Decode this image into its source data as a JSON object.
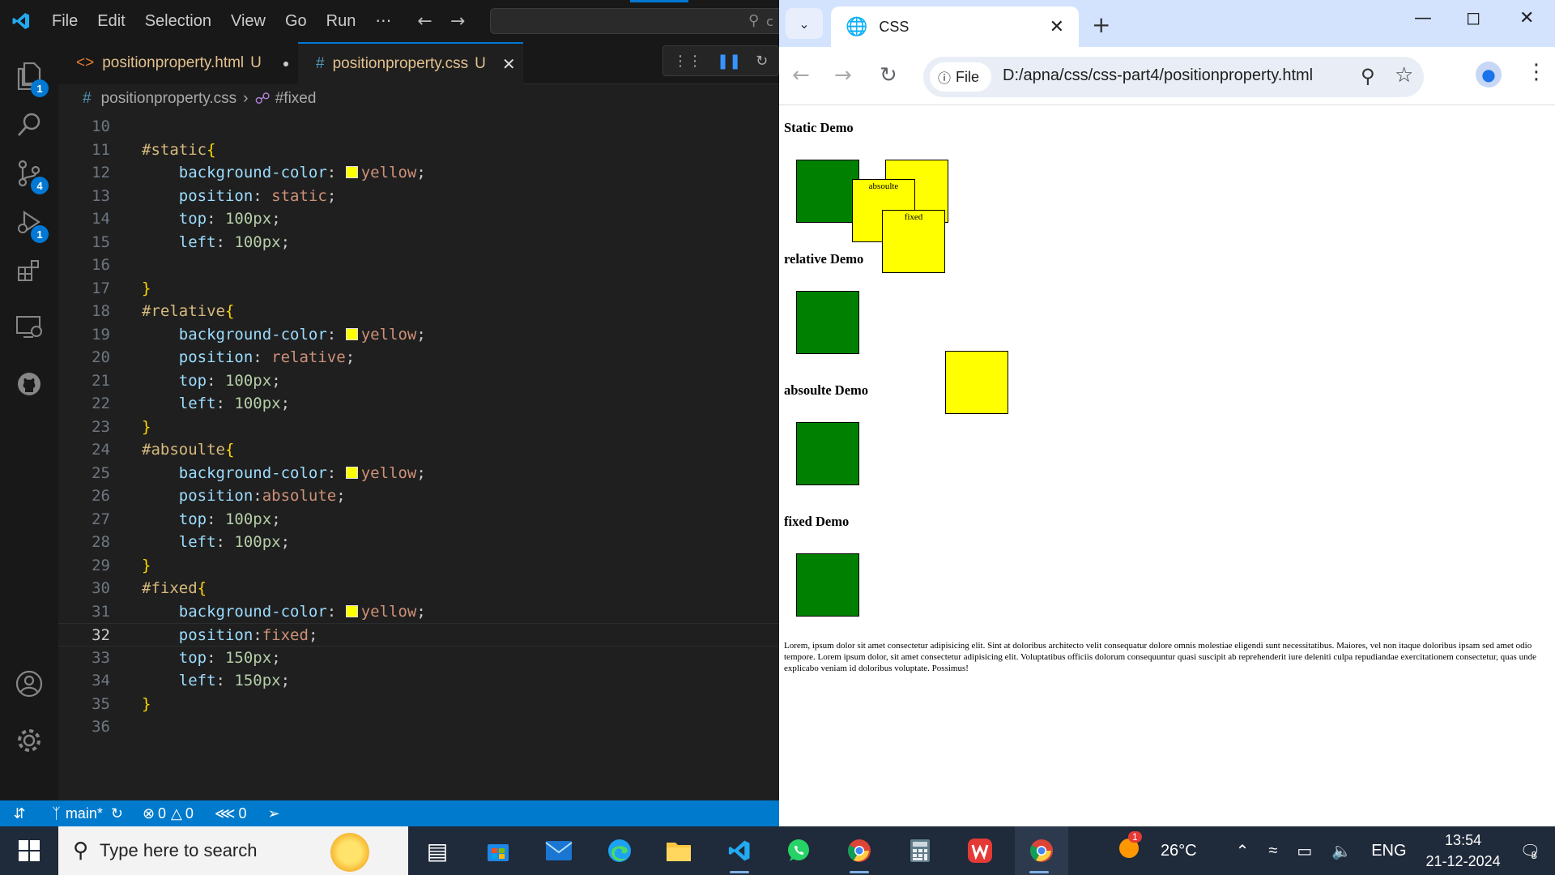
{
  "vscode": {
    "menu": [
      "File",
      "Edit",
      "Selection",
      "View",
      "Go",
      "Run",
      "⋯"
    ],
    "search_text": "c",
    "activity_badges": {
      "explorer": "1",
      "source_control": "4",
      "debug": "1"
    },
    "tabs": [
      {
        "label": "positionproperty.html",
        "status": "U"
      },
      {
        "label": "positionproperty.css",
        "status": "U"
      }
    ],
    "breadcrumb": {
      "file": "positionproperty.css",
      "symbol": "#fixed"
    },
    "lines": [
      {
        "n": "10",
        "parts": []
      },
      {
        "n": "11",
        "parts": [
          [
            "sel",
            "#static"
          ],
          [
            "brace",
            "{"
          ]
        ]
      },
      {
        "n": "12",
        "parts": [
          [
            "ind",
            "    "
          ],
          [
            "prop",
            "background-color"
          ],
          [
            "punc",
            ": "
          ],
          [
            "swatch",
            "#ffff00"
          ],
          [
            "val",
            "yellow"
          ],
          [
            "punc",
            ";"
          ]
        ]
      },
      {
        "n": "13",
        "parts": [
          [
            "ind",
            "    "
          ],
          [
            "prop",
            "position"
          ],
          [
            "punc",
            ": "
          ],
          [
            "val",
            "static"
          ],
          [
            "punc",
            ";"
          ]
        ]
      },
      {
        "n": "14",
        "parts": [
          [
            "ind",
            "    "
          ],
          [
            "prop",
            "top"
          ],
          [
            "punc",
            ": "
          ],
          [
            "num",
            "100px"
          ],
          [
            "punc",
            ";"
          ]
        ]
      },
      {
        "n": "15",
        "parts": [
          [
            "ind",
            "    "
          ],
          [
            "prop",
            "left"
          ],
          [
            "punc",
            ": "
          ],
          [
            "num",
            "100px"
          ],
          [
            "punc",
            ";"
          ]
        ]
      },
      {
        "n": "16",
        "parts": []
      },
      {
        "n": "17",
        "parts": [
          [
            "brace",
            "}"
          ]
        ]
      },
      {
        "n": "18",
        "parts": [
          [
            "sel",
            "#relative"
          ],
          [
            "brace",
            "{"
          ]
        ]
      },
      {
        "n": "19",
        "parts": [
          [
            "ind",
            "    "
          ],
          [
            "prop",
            "background-color"
          ],
          [
            "punc",
            ": "
          ],
          [
            "swatch",
            "#ffff00"
          ],
          [
            "val",
            "yellow"
          ],
          [
            "punc",
            ";"
          ]
        ]
      },
      {
        "n": "20",
        "parts": [
          [
            "ind",
            "    "
          ],
          [
            "prop",
            "position"
          ],
          [
            "punc",
            ": "
          ],
          [
            "val",
            "relative"
          ],
          [
            "punc",
            ";"
          ]
        ]
      },
      {
        "n": "21",
        "parts": [
          [
            "ind",
            "    "
          ],
          [
            "prop",
            "top"
          ],
          [
            "punc",
            ": "
          ],
          [
            "num",
            "100px"
          ],
          [
            "punc",
            ";"
          ]
        ]
      },
      {
        "n": "22",
        "parts": [
          [
            "ind",
            "    "
          ],
          [
            "prop",
            "left"
          ],
          [
            "punc",
            ": "
          ],
          [
            "num",
            "100px"
          ],
          [
            "punc",
            ";"
          ]
        ]
      },
      {
        "n": "23",
        "parts": [
          [
            "brace",
            "}"
          ]
        ]
      },
      {
        "n": "24",
        "parts": [
          [
            "sel",
            "#absoulte"
          ],
          [
            "brace",
            "{"
          ]
        ]
      },
      {
        "n": "25",
        "parts": [
          [
            "ind",
            "    "
          ],
          [
            "prop",
            "background-color"
          ],
          [
            "punc",
            ": "
          ],
          [
            "swatch",
            "#ffff00"
          ],
          [
            "val",
            "yellow"
          ],
          [
            "punc",
            ";"
          ]
        ]
      },
      {
        "n": "26",
        "parts": [
          [
            "ind",
            "    "
          ],
          [
            "prop",
            "position"
          ],
          [
            "punc",
            ":"
          ],
          [
            "val",
            "absolute"
          ],
          [
            "punc",
            ";"
          ]
        ]
      },
      {
        "n": "27",
        "parts": [
          [
            "ind",
            "    "
          ],
          [
            "prop",
            "top"
          ],
          [
            "punc",
            ": "
          ],
          [
            "num",
            "100px"
          ],
          [
            "punc",
            ";"
          ]
        ]
      },
      {
        "n": "28",
        "parts": [
          [
            "ind",
            "    "
          ],
          [
            "prop",
            "left"
          ],
          [
            "punc",
            ": "
          ],
          [
            "num",
            "100px"
          ],
          [
            "punc",
            ";"
          ]
        ]
      },
      {
        "n": "29",
        "parts": [
          [
            "brace",
            "}"
          ]
        ]
      },
      {
        "n": "30",
        "parts": [
          [
            "sel",
            "#fixed"
          ],
          [
            "brace",
            "{"
          ]
        ]
      },
      {
        "n": "31",
        "parts": [
          [
            "ind",
            "    "
          ],
          [
            "prop",
            "background-color"
          ],
          [
            "punc",
            ": "
          ],
          [
            "swatch",
            "#ffff00"
          ],
          [
            "val",
            "yellow"
          ],
          [
            "punc",
            ";"
          ]
        ]
      },
      {
        "n": "32",
        "parts": [
          [
            "ind",
            "    "
          ],
          [
            "prop",
            "position"
          ],
          [
            "punc",
            ":"
          ],
          [
            "val",
            "fixed"
          ],
          [
            "punc",
            ";"
          ]
        ],
        "current": true
      },
      {
        "n": "33",
        "parts": [
          [
            "ind",
            "    "
          ],
          [
            "prop",
            "top"
          ],
          [
            "punc",
            ": "
          ],
          [
            "num",
            "150px"
          ],
          [
            "punc",
            ";"
          ]
        ]
      },
      {
        "n": "34",
        "parts": [
          [
            "ind",
            "    "
          ],
          [
            "prop",
            "left"
          ],
          [
            "punc",
            ": "
          ],
          [
            "num",
            "150px"
          ],
          [
            "punc",
            ";"
          ]
        ]
      },
      {
        "n": "35",
        "parts": [
          [
            "brace",
            "}"
          ]
        ]
      },
      {
        "n": "36",
        "parts": []
      }
    ],
    "status": {
      "branch": "main*",
      "errors": "0",
      "warnings": "0",
      "ports": "0"
    }
  },
  "chrome": {
    "tab_title": "CSS",
    "chip": "File",
    "url": "D:/apna/css/css-part4/positionproperty.html",
    "page": {
      "headings": [
        "Static Demo",
        "relative Demo",
        "absoulte Demo",
        "fixed Demo"
      ],
      "box_absolute_label": "absoulte",
      "box_fixed_label": "fixed",
      "lorem": "Lorem, ipsum dolor sit amet consectetur adipisicing elit. Sint at doloribus architecto velit consequatur dolore omnis molestiae eligendi sunt necessitatibus. Maiores, vel non itaque doloribus ipsam sed amet odio tempore. Lorem ipsum dolor, sit amet consectetur adipisicing elit. Voluptatibus officiis dolorum consequuntur quasi suscipit ab reprehenderit iure deleniti culpa repudiandae exercitationem consectetur, quas unde explicabo veniam id doloribus voluptate. Possimus!"
    }
  },
  "taskbar": {
    "search_placeholder": "Type here to search",
    "temperature": "26°C",
    "weather_badge": "1",
    "language": "ENG",
    "time": "13:54",
    "date": "21-12-2024",
    "notifications": "8"
  },
  "colors": {
    "accent": "#0078d4",
    "statusbar": "#007acc",
    "green_box": "#008000",
    "yellow_box": "#ffff00"
  }
}
